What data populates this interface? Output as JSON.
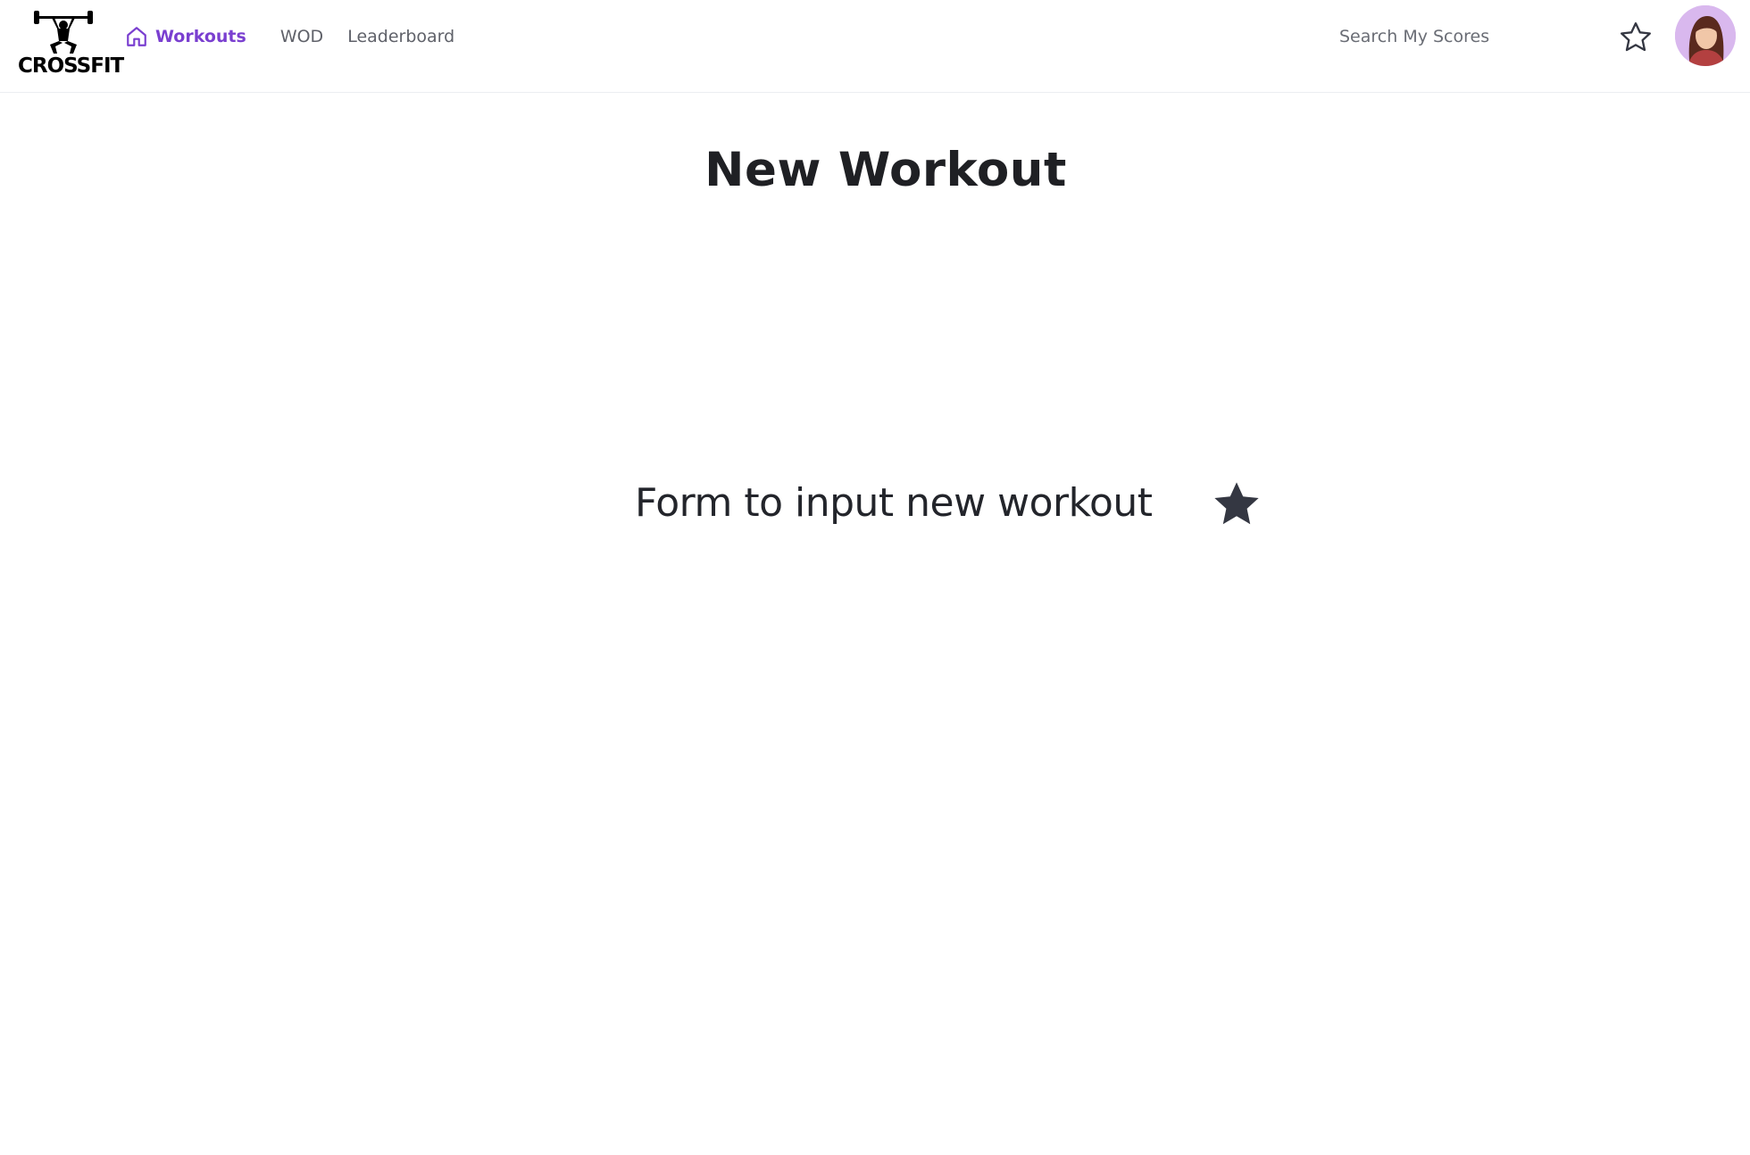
{
  "brand": {
    "logo_text": "CROSSFIT"
  },
  "nav": {
    "items": [
      {
        "label": "Workouts",
        "active": true,
        "icon": "home-icon"
      },
      {
        "label": "WOD",
        "active": false
      },
      {
        "label": "Leaderboard",
        "active": false
      }
    ]
  },
  "header": {
    "search_placeholder": "Search My Scores",
    "favorites_icon": "star-outline-icon",
    "avatar_icon": "user-avatar"
  },
  "main": {
    "title": "New Workout",
    "form_placeholder_text": "Form to input new workout",
    "form_icon": "star-filled-icon"
  },
  "colors": {
    "accent": "#7a3fd0",
    "text": "#1f2024",
    "muted": "#5f6169",
    "avatar_bg": "#d9b8ee",
    "star_fill": "#343742"
  }
}
